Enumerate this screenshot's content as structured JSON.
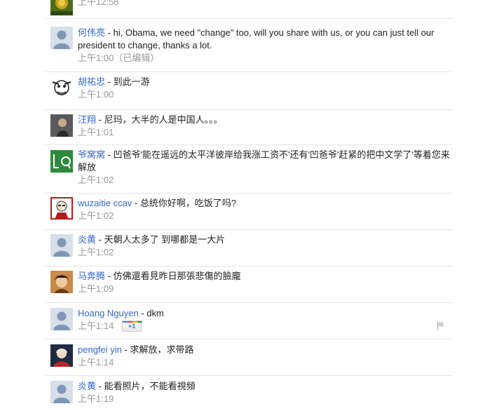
{
  "comments": [
    {
      "author": "",
      "text": "",
      "time": "上午12:58",
      "edited": ""
    },
    {
      "author": "何伟亮",
      "text": "hi, Obama, we need \"change\" too, will you share with us, or you can just tell our president to change, thanks a lot.",
      "time": "上午1:00",
      "edited": "（已编辑）"
    },
    {
      "author": "胡祐忠",
      "text": "到此一游",
      "time": "上午1:00"
    },
    {
      "author": "汪翔",
      "text": "尼玛，大半的人是中国人。。。",
      "time": "上午1:01"
    },
    {
      "author": "爷窝窝",
      "text": "凹爸爷'能在遥远的太平洋彼岸给我涨工资不'还有'凹爸爷'赶紧的把中文学了'等着您来解放",
      "time": "上午1:02"
    },
    {
      "author": "wuzaitie ccav",
      "text": "总统你好啊，吃饭了吗?",
      "time": "上午1:02"
    },
    {
      "author": "炎黄",
      "text": "天朝人太多了 到哪都是一大片",
      "time": "上午1:02"
    },
    {
      "author": "马奔腾",
      "text": "仿佛還看見昨日那張悲傷的臉龐",
      "time": "上午1:09"
    },
    {
      "author": "Hoang Nguyen",
      "text": "dkm",
      "time": "上午1:14",
      "plus_one": "+1"
    },
    {
      "author": "pengfei yin",
      "text": "求解放，求带路",
      "time": "上午1:14"
    },
    {
      "author": "炎黄",
      "text": "能看照片，不能看視頻",
      "time": "上午1:19"
    }
  ],
  "separator": "-",
  "colors": {
    "link": "#3366cc",
    "timestamp": "#999999",
    "divider": "#e5e5e5"
  }
}
